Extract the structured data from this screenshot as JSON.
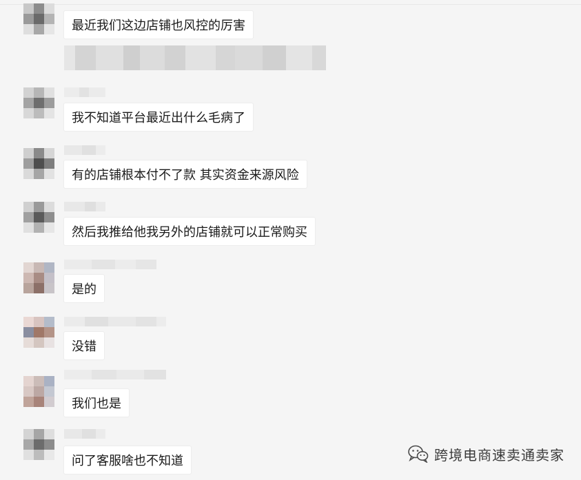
{
  "messages": [
    {
      "text": "最近我们这边店铺也风控的厉害"
    },
    {
      "text": "我不知道平台最近出什么毛病了"
    },
    {
      "text": "有的店铺根本付不了款 其实资金来源风险"
    },
    {
      "text": "然后我推给他我另外的店铺就可以正常购买"
    },
    {
      "text": "是的"
    },
    {
      "text": "没错"
    },
    {
      "text": "我们也是"
    },
    {
      "text": "问了客服啥也不知道"
    }
  ],
  "watermark": {
    "text": "跨境电商速卖通卖家",
    "icon": "wechat-icon"
  },
  "colors": {
    "bubble": "#ffffff",
    "background": "#f5f5f5",
    "text": "#1a1a1a"
  }
}
